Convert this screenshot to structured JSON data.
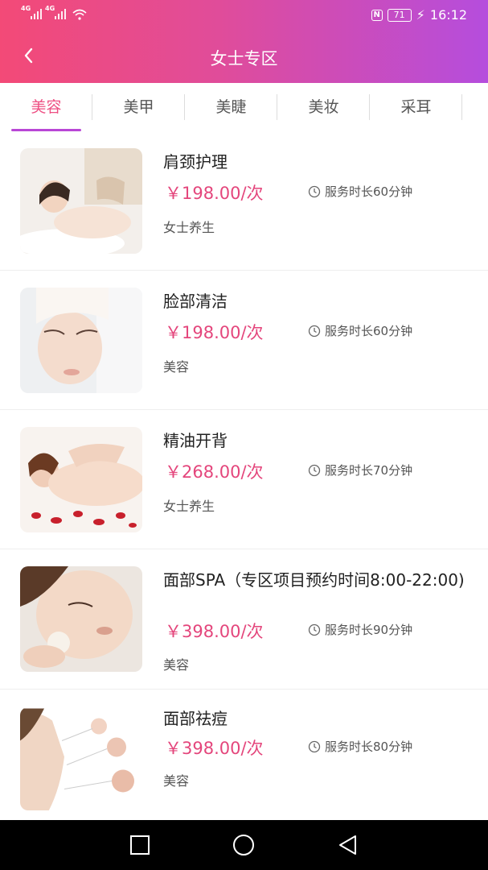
{
  "status": {
    "time": "16:12",
    "battery": "71",
    "net1": "4G",
    "net2": "4G",
    "nfc": "N"
  },
  "header": {
    "title": "女士专区"
  },
  "tabs": [
    {
      "label": "美容"
    },
    {
      "label": "美甲"
    },
    {
      "label": "美睫"
    },
    {
      "label": "美妆"
    },
    {
      "label": "采耳"
    }
  ],
  "items": [
    {
      "name": "肩颈护理",
      "price": "￥198.00/次",
      "duration": "服务时长60分钟",
      "category": "女士养生"
    },
    {
      "name": "脸部清洁",
      "price": "￥198.00/次",
      "duration": "服务时长60分钟",
      "category": "美容"
    },
    {
      "name": "精油开背",
      "price": "￥268.00/次",
      "duration": "服务时长70分钟",
      "category": "女士养生"
    },
    {
      "name": "面部SPA（专区项目预约时间8:00-22:00)",
      "price": "￥398.00/次",
      "duration": "服务时长90分钟",
      "category": "美容"
    },
    {
      "name": "面部祛痘",
      "price": "￥398.00/次",
      "duration": "服务时长80分钟",
      "category": "美容"
    }
  ]
}
